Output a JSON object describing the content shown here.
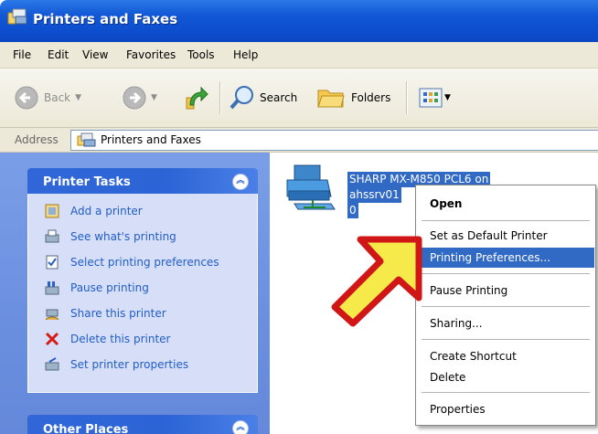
{
  "window": {
    "title": "Printers and Faxes"
  },
  "menu": [
    "File",
    "Edit",
    "View",
    "Favorites",
    "Tools",
    "Help"
  ],
  "toolbar": {
    "back_label": "Back",
    "search_label": "Search",
    "folders_label": "Folders"
  },
  "address": {
    "label": "Address",
    "value": "Printers and Faxes"
  },
  "printer_tasks": {
    "title": "Printer Tasks",
    "items": [
      "Add a printer",
      "See what's printing",
      "Select printing preferences",
      "Pause printing",
      "Share this printer",
      "Delete this printer",
      "Set printer properties"
    ]
  },
  "other_places": {
    "title": "Other Places"
  },
  "printer": {
    "name_lines": [
      "SHARP MX-M850 PCL6 on",
      "ahssrv01",
      "0"
    ]
  },
  "context_menu": {
    "items": [
      "Open",
      "Set as Default Printer",
      "Printing Preferences...",
      "Pause Printing",
      "Sharing...",
      "Create Shortcut",
      "Delete",
      "Properties"
    ],
    "highlighted": "Printing Preferences..."
  },
  "colors": {
    "titlebar": "#0d4fcf",
    "selection": "#316ac5",
    "task_link": "#215dc6",
    "arrow_fill": "#f6e94a",
    "arrow_border": "#d01616"
  }
}
